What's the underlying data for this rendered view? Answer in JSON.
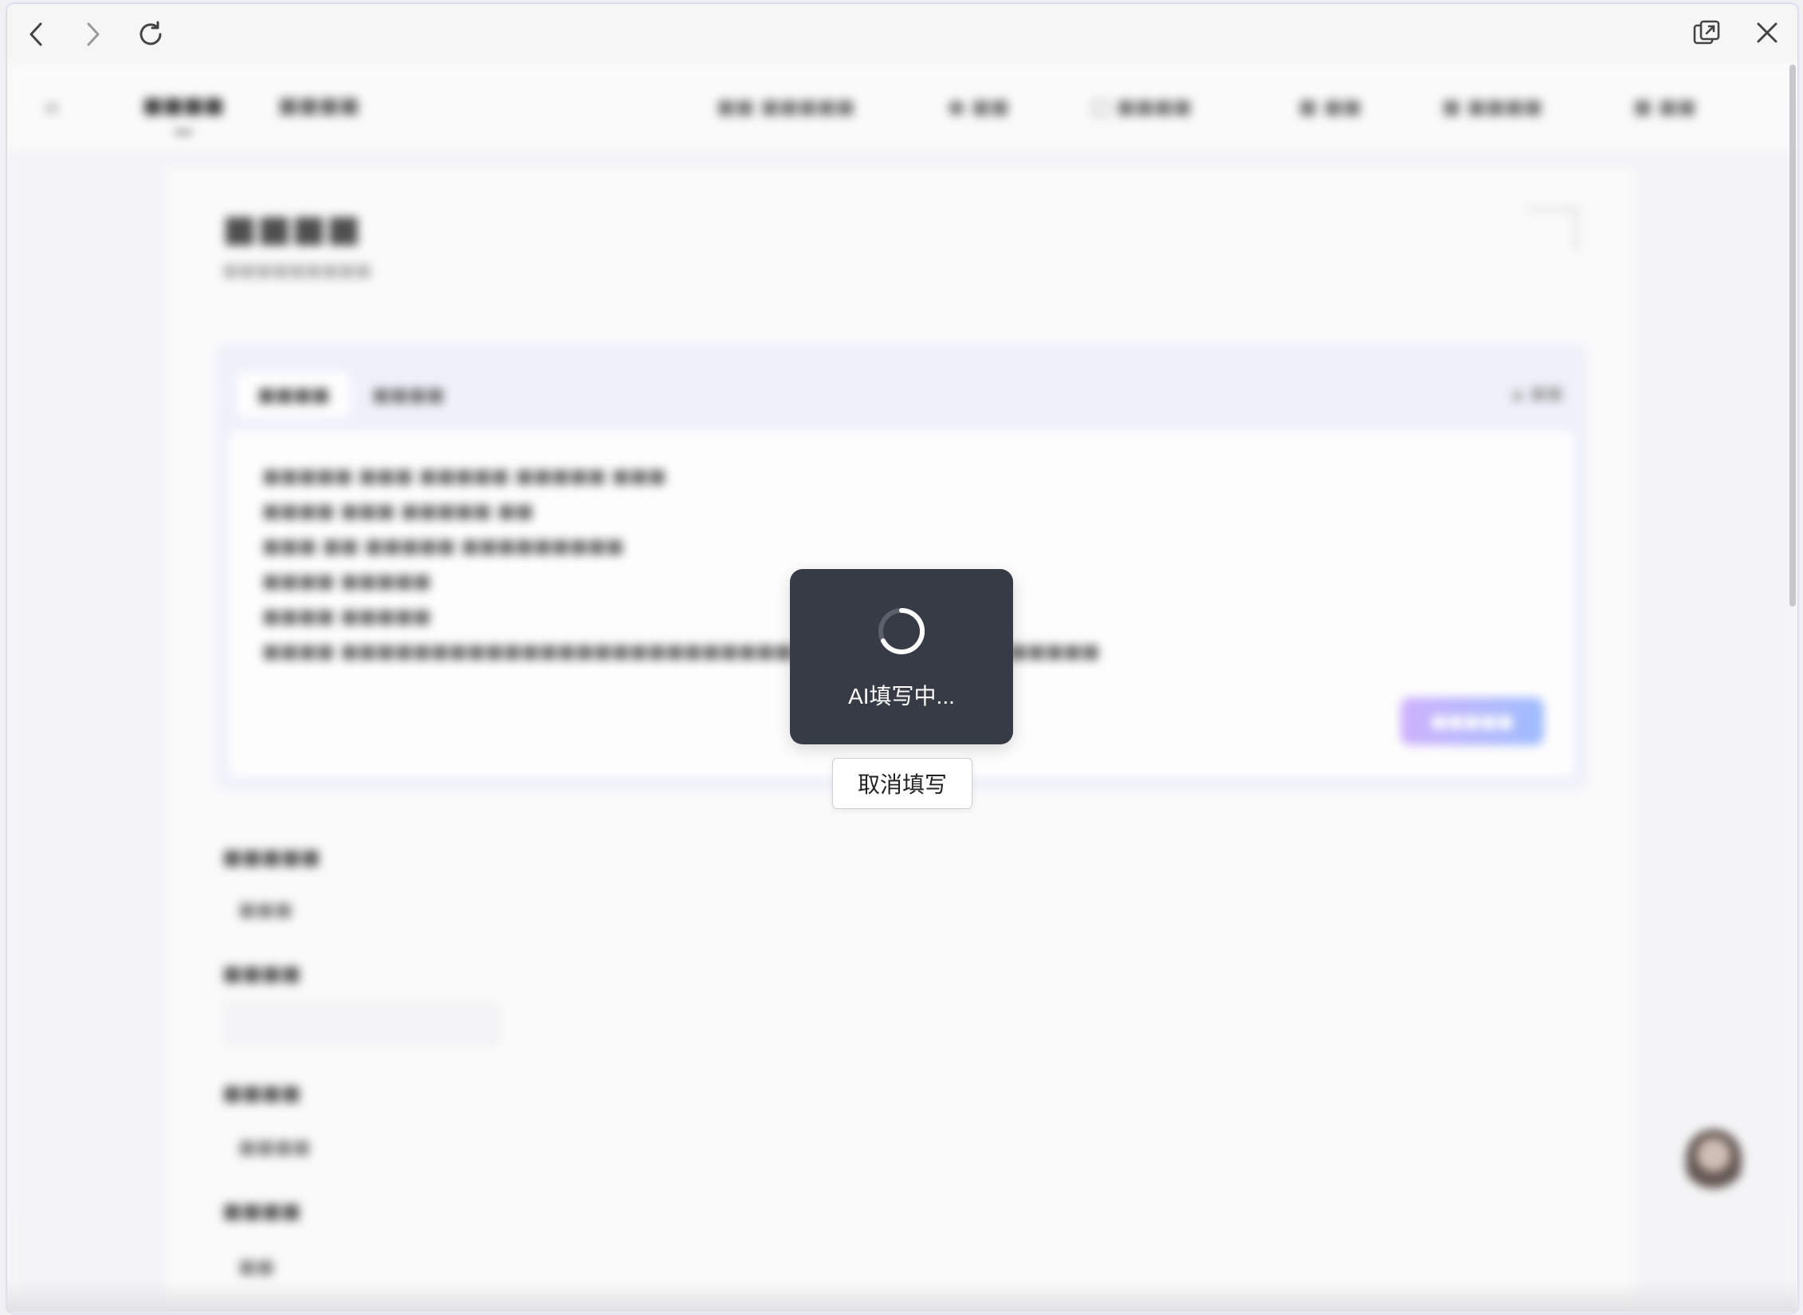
{
  "chrome": {
    "back_icon": "chevron-left-icon",
    "forward_icon": "chevron-right-icon",
    "reload_icon": "reload-icon",
    "open_external_icon": "open-external-icon",
    "close_icon": "close-icon"
  },
  "overlay": {
    "loading_text": "AI填写中...",
    "cancel_label": "取消填写",
    "background_color": "#373b46"
  }
}
